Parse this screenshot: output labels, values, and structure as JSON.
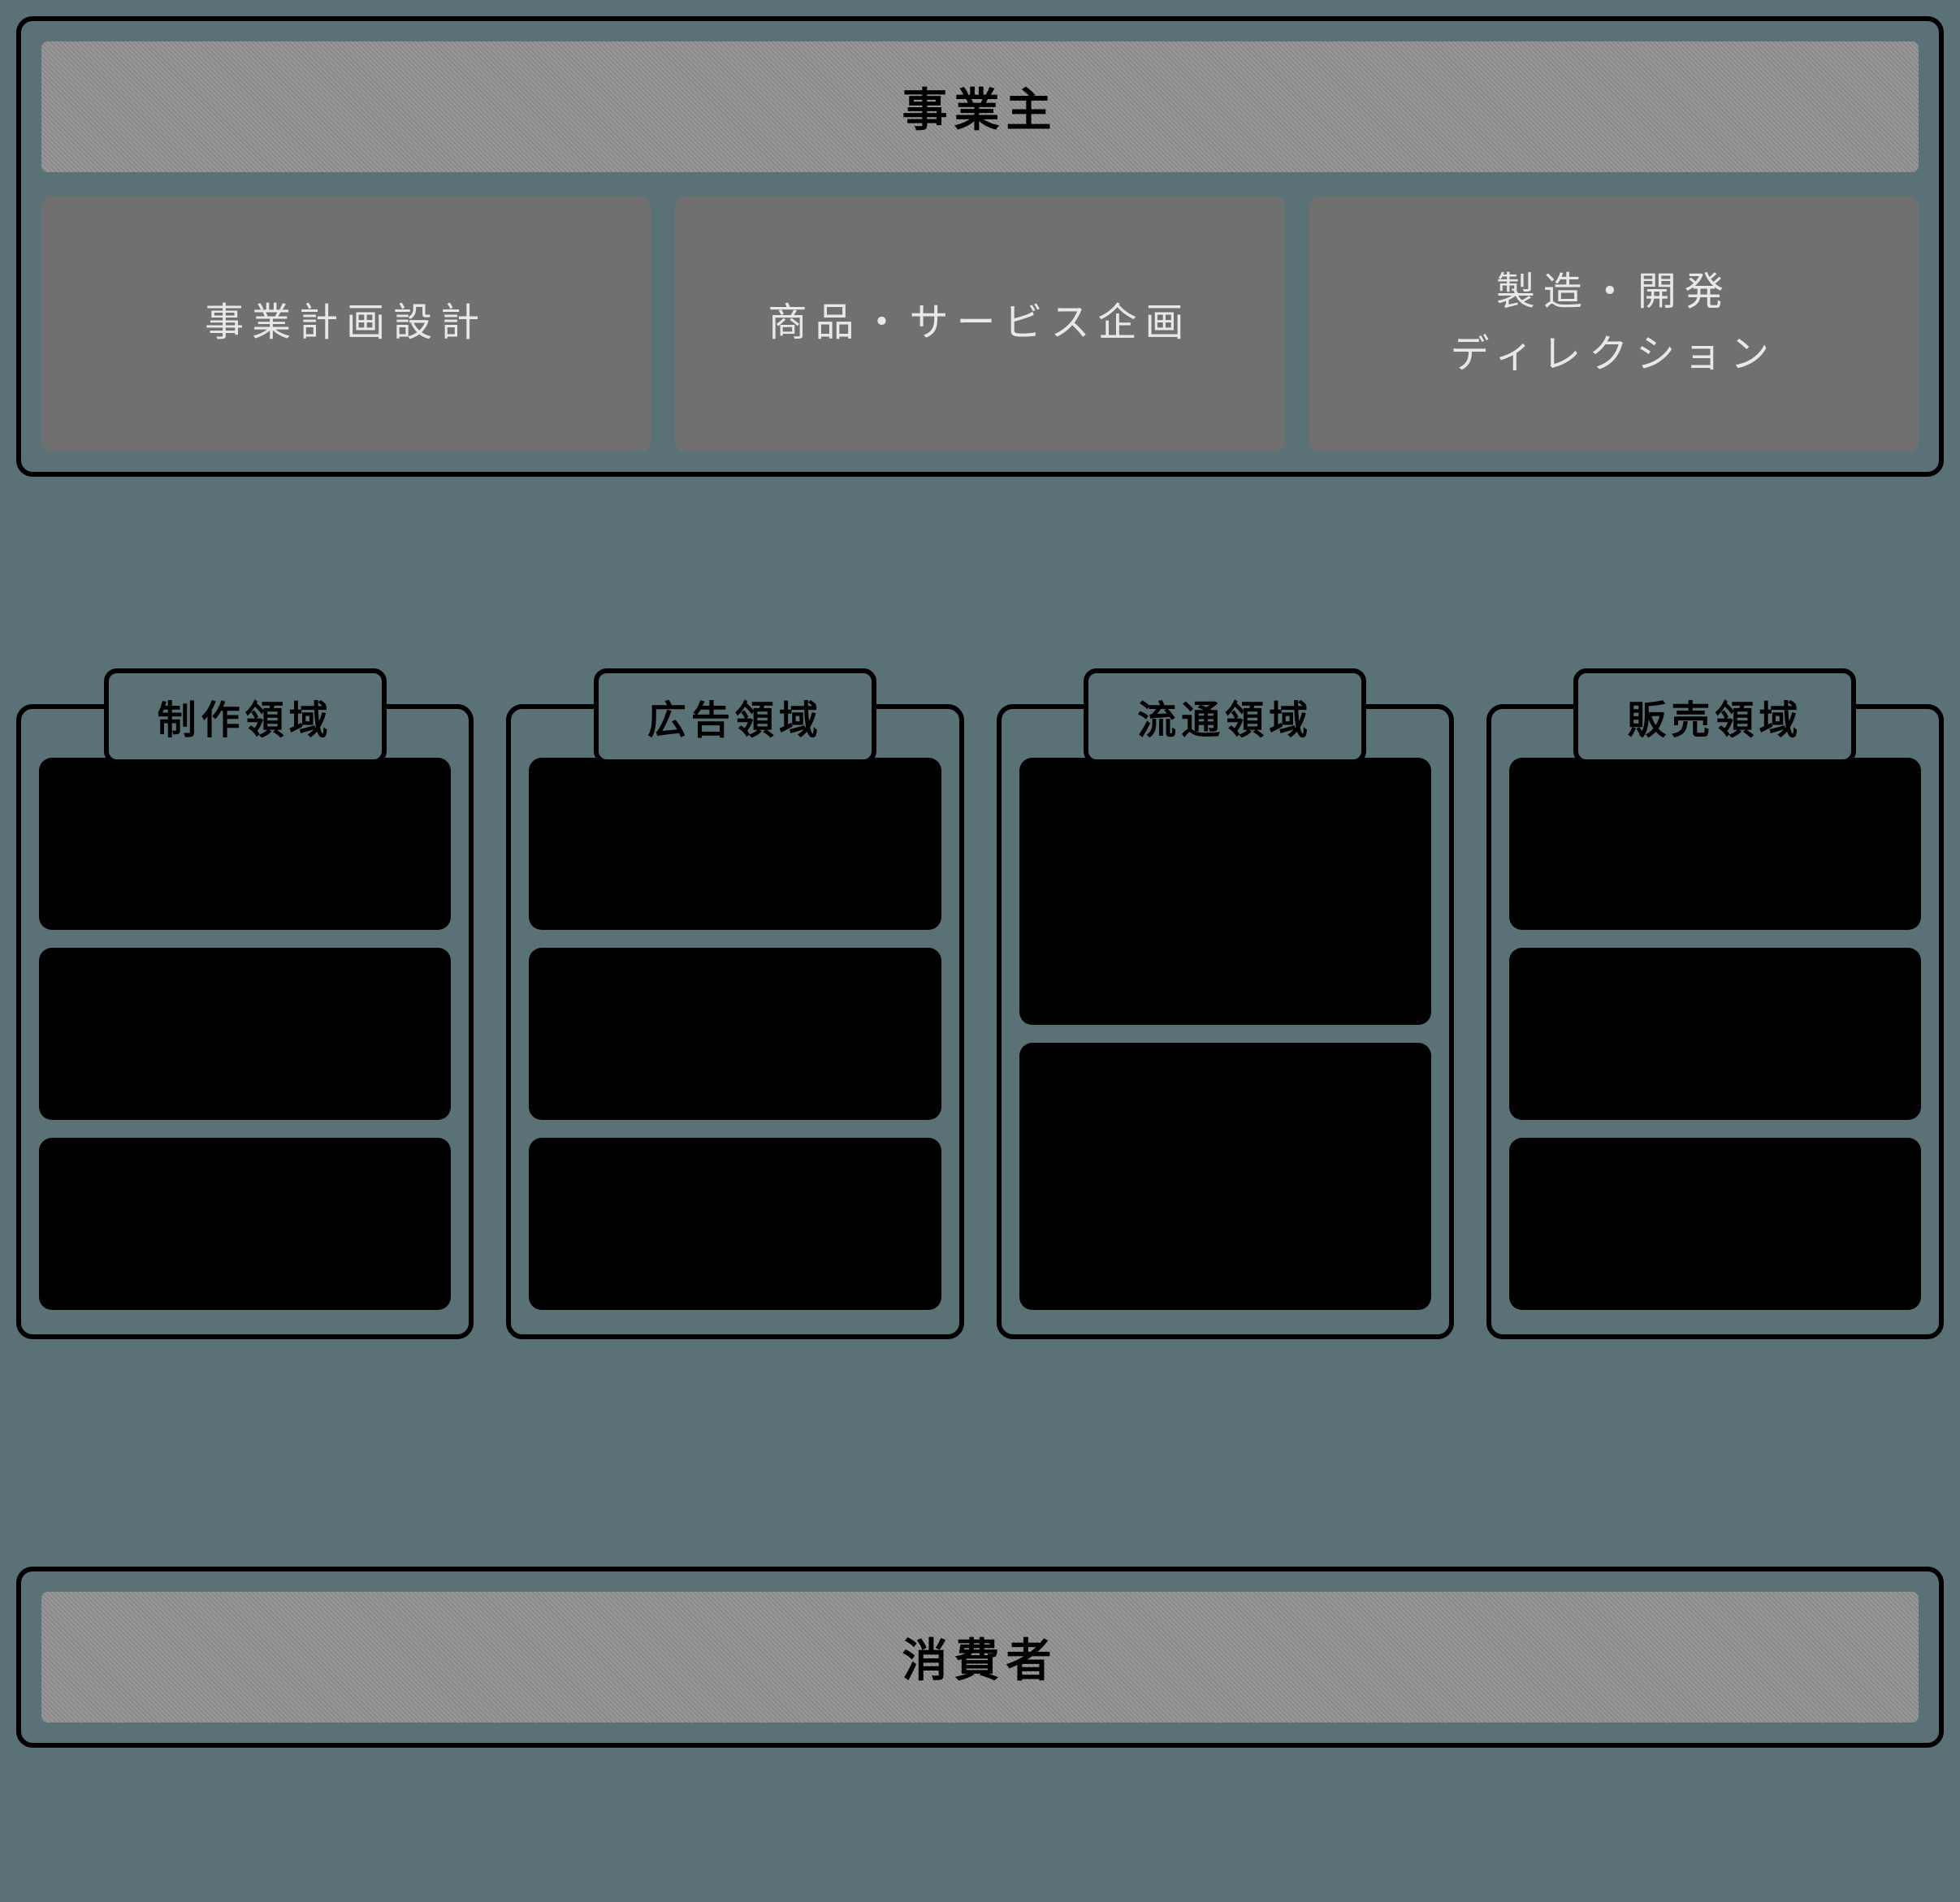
{
  "top": {
    "header": "事業主",
    "cards": [
      "事業計画設計",
      "商品・サービス企画",
      "製造・開発\nディレクション"
    ]
  },
  "domains": [
    {
      "title": "制作領域",
      "itemCount": 3,
      "layout": "equal"
    },
    {
      "title": "広告領域",
      "itemCount": 3,
      "layout": "equal"
    },
    {
      "title": "流通領域",
      "itemCount": 2,
      "layout": "tall"
    },
    {
      "title": "販売領域",
      "itemCount": 3,
      "layout": "equal"
    }
  ],
  "bottom": {
    "header": "消費者"
  }
}
